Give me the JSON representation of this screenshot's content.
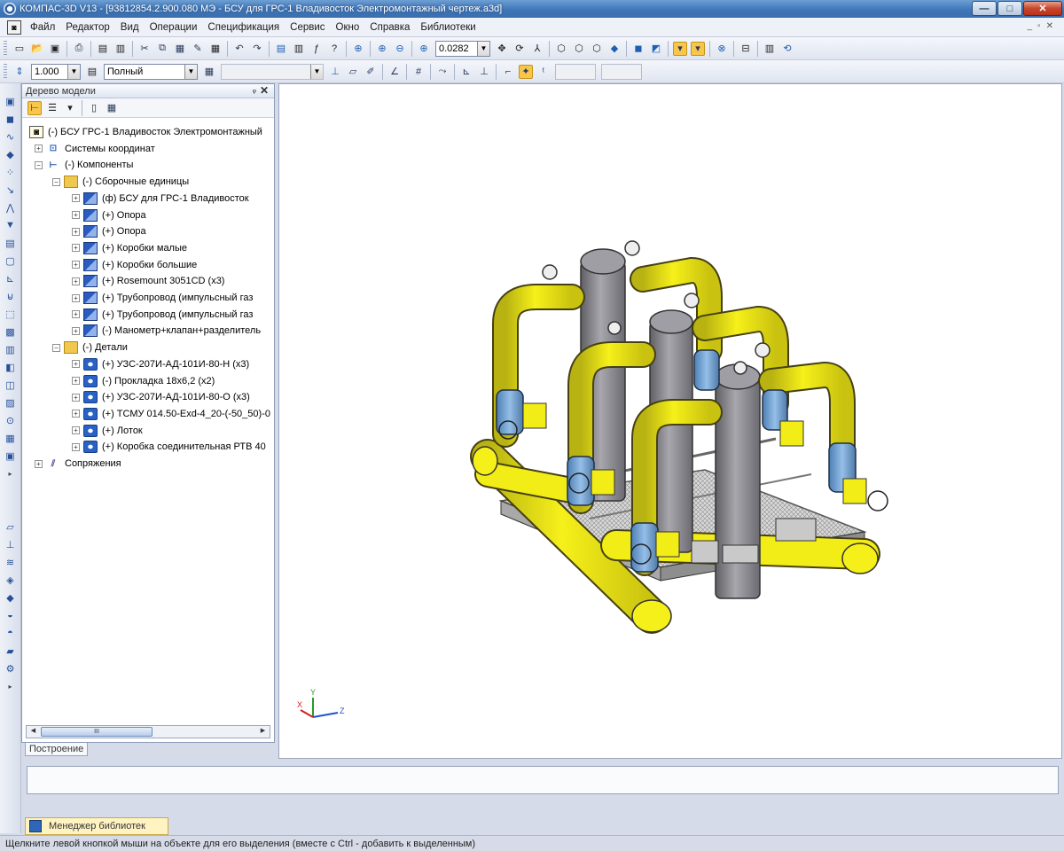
{
  "window": {
    "title": "КОМПАС-3D V13 - [93812854.2.900.080 МЭ - БСУ для ГРС-1 Владивосток Электромонтажный чертеж.a3d]",
    "buttons": {
      "minimize": "—",
      "maximize": "□",
      "close": "✕"
    }
  },
  "menu": {
    "items": [
      {
        "label": "Файл"
      },
      {
        "label": "Редактор"
      },
      {
        "label": "Вид"
      },
      {
        "label": "Операции"
      },
      {
        "label": "Спецификация"
      },
      {
        "label": "Сервис"
      },
      {
        "label": "Окно"
      },
      {
        "label": "Справка"
      },
      {
        "label": "Библиотеки"
      }
    ]
  },
  "toolbar": {
    "zoom_value": "0.0282",
    "step_value": "1.000",
    "mode_value": "Полный",
    "empty_combo_value": ""
  },
  "tree_panel": {
    "title": "Дерево модели",
    "pin": "ᵩ",
    "close": "✕",
    "nodes": [
      {
        "label": "(-) БСУ ГРС-1 Владивосток Электромонтажный",
        "icon": "assembly-doc-icon"
      },
      {
        "label": "Системы координат",
        "icon": "coordinate-systems-icon"
      },
      {
        "label": "(-) Компоненты",
        "icon": "components-icon"
      },
      {
        "label": "(-) Сборочные единицы",
        "icon": "folder-icon"
      },
      {
        "label": "(ф) БСУ для ГРС-1 Владивосток",
        "icon": "assembly-icon"
      },
      {
        "label": "(+) Опора",
        "icon": "assembly-icon"
      },
      {
        "label": "(+) Опора",
        "icon": "assembly-icon"
      },
      {
        "label": "(+) Коробки малые",
        "icon": "assembly-icon"
      },
      {
        "label": "(+) Коробки большие",
        "icon": "assembly-icon"
      },
      {
        "label": "(+) Rosemount 3051CD (x3)",
        "icon": "assembly-icon"
      },
      {
        "label": "(+) Трубопровод  (импульсный газ",
        "icon": "assembly-icon"
      },
      {
        "label": "(+) Трубопровод  (импульсный газ",
        "icon": "assembly-icon"
      },
      {
        "label": "(-) Манометр+клапан+разделитель",
        "icon": "assembly-icon"
      },
      {
        "label": "(-) Детали",
        "icon": "folder-icon"
      },
      {
        "label": "(+) УЗС-207И-АД-101И-80-Н (x3)",
        "icon": "part-icon"
      },
      {
        "label": "(-) Прокладка 18x6,2 (x2)",
        "icon": "part-icon"
      },
      {
        "label": "(+) УЗС-207И-АД-101И-80-О (x3)",
        "icon": "part-icon"
      },
      {
        "label": "(+) ТСМУ 014.50-Exd-4_20-(-50_50)-0",
        "icon": "part-icon"
      },
      {
        "label": "(+) Лоток",
        "icon": "part-icon"
      },
      {
        "label": "(+) Коробка соединительная РТВ 40",
        "icon": "part-icon"
      },
      {
        "label": "Сопряжения",
        "icon": "mates-icon"
      }
    ],
    "scroll_thumb_label": "III",
    "tab_label": "Построение"
  },
  "library_manager": {
    "label": "Менеджер библиотек"
  },
  "status": {
    "text": "Щелкните левой кнопкой мыши на объекте для его выделения (вместе с Ctrl - добавить к выделенным)"
  },
  "axes": {
    "x": "X",
    "y": "Y",
    "z": "Z"
  },
  "colors": {
    "pipe_yellow": "#f2ec17",
    "vessel_gray": "#8e8e93",
    "valve_blue": "#6fa3d8",
    "frame_gray": "#9a9a9a",
    "titlebar_blue": "#3f76b8"
  }
}
